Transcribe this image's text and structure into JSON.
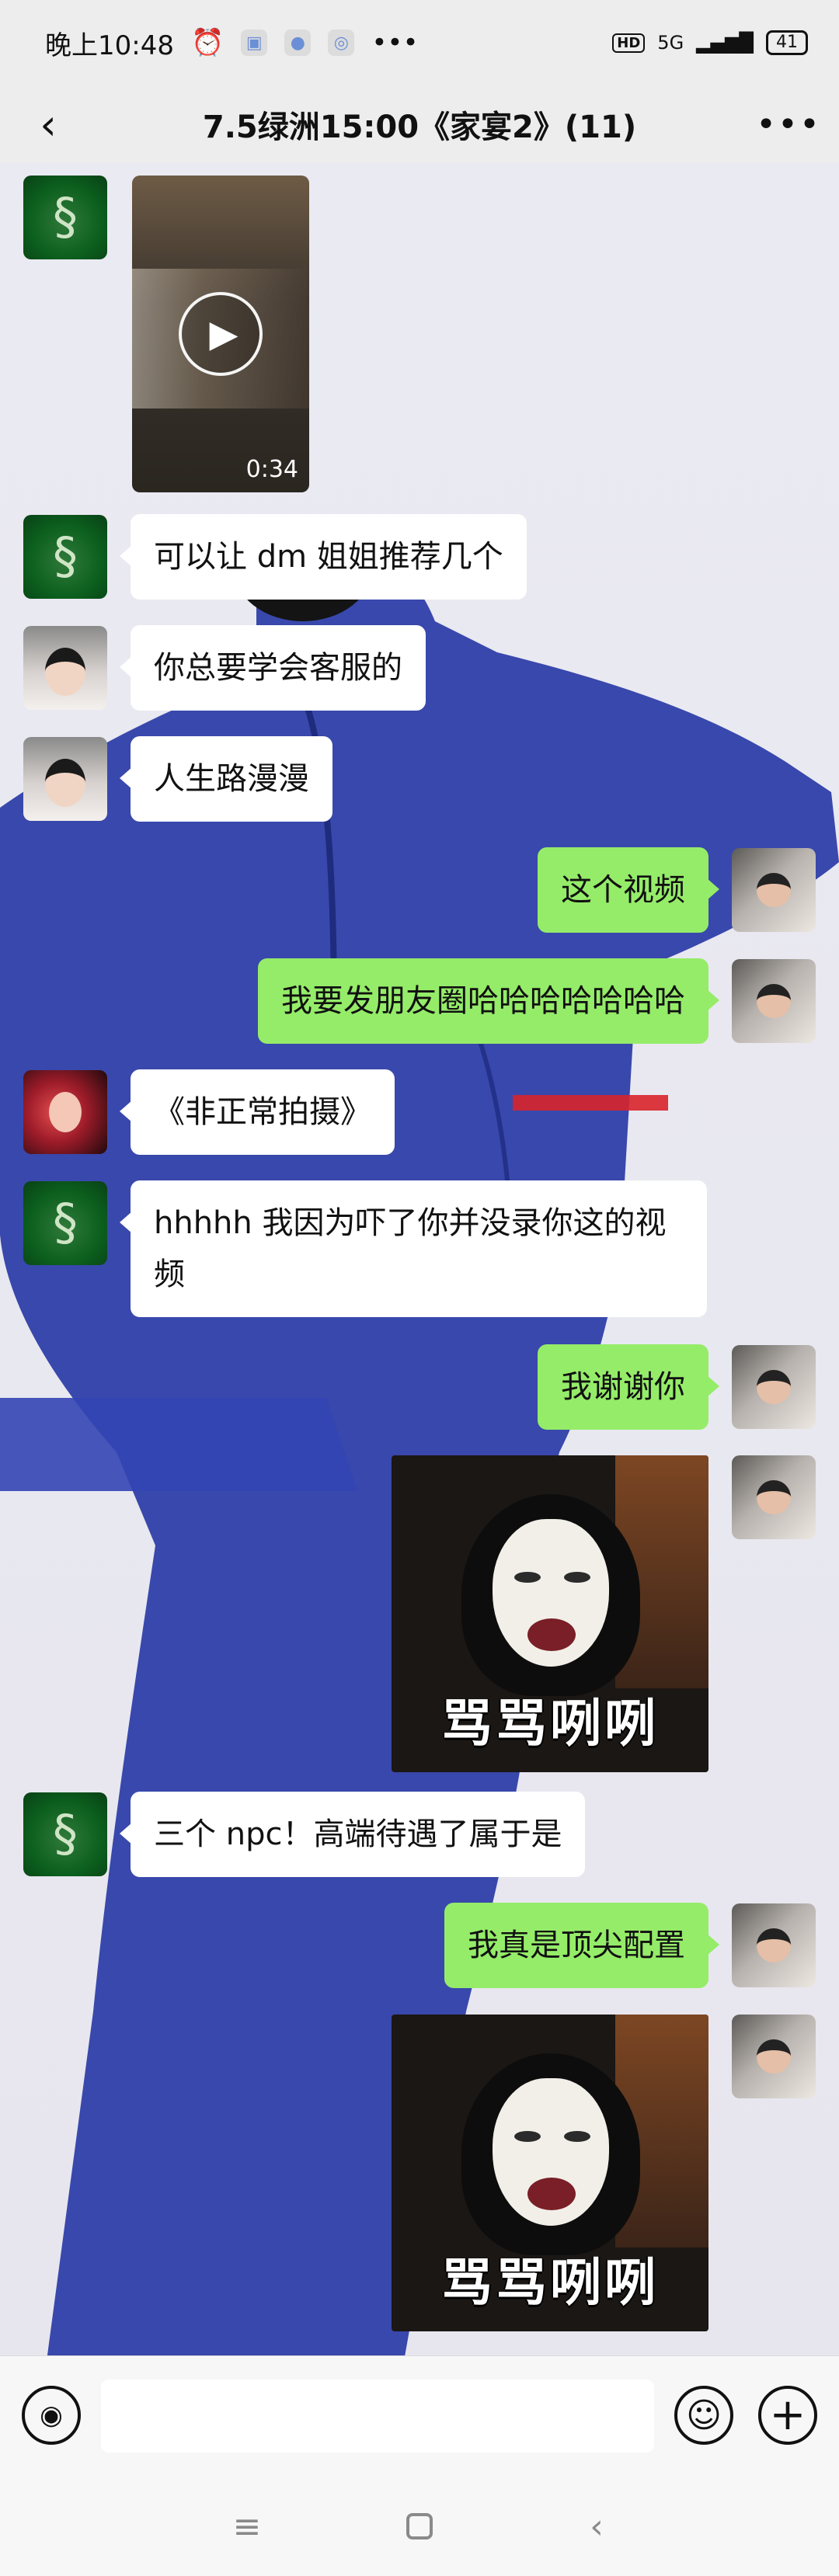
{
  "status_bar": {
    "time": "晚上10:48",
    "hd": "HD",
    "network": "5G",
    "battery": "41"
  },
  "header": {
    "title": "7.5绿洲15:00《家宴2》(11)",
    "back_icon": "chevron-left-icon",
    "more_icon": "ellipsis-icon"
  },
  "messages": [
    {
      "side": "in",
      "type": "video",
      "duration": "0:34"
    },
    {
      "side": "in",
      "type": "text",
      "text": "可以让 dm 姐姐推荐几个"
    },
    {
      "side": "in",
      "type": "text",
      "text": "你总要学会客服的"
    },
    {
      "side": "in",
      "type": "text",
      "text": "人生路漫漫"
    },
    {
      "side": "out",
      "type": "text",
      "text": "这个视频"
    },
    {
      "side": "out",
      "type": "text",
      "text": "我要发朋友圈哈哈哈哈哈哈哈"
    },
    {
      "side": "in",
      "type": "text",
      "text": "《非正常拍摄》"
    },
    {
      "side": "in",
      "type": "text",
      "text": "hhhhh 我因为吓了你并没录你这的视频"
    },
    {
      "side": "out",
      "type": "text",
      "text": "我谢谢你"
    },
    {
      "side": "out",
      "type": "sticker",
      "caption": "骂骂咧咧"
    },
    {
      "side": "in",
      "type": "text",
      "text": "三个 npc！高端待遇了属于是"
    },
    {
      "side": "out",
      "type": "text",
      "text": "我真是顶尖配置"
    },
    {
      "side": "out",
      "type": "sticker",
      "caption": "骂骂咧咧"
    }
  ],
  "input_bar": {
    "value": "",
    "voice_icon": "voice-icon",
    "emoji_icon": "emoji-icon",
    "plus_icon": "plus-icon"
  },
  "nav": {
    "menu_icon": "menu-icon",
    "home_icon": "home-icon",
    "back_icon": "back-triangle-icon"
  },
  "colors": {
    "outgoing_bubble": "#95ec69",
    "incoming_bubble": "#ffffff",
    "chat_bg": "#e9e9f1",
    "header_bg": "#ededed"
  }
}
